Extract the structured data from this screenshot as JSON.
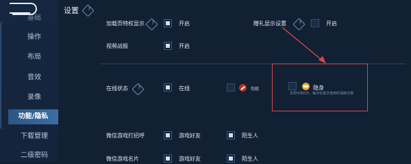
{
  "sidebar": {
    "items": [
      {
        "label": "基础"
      },
      {
        "label": "操作"
      },
      {
        "label": "布局"
      },
      {
        "label": "音效"
      },
      {
        "label": "录像"
      },
      {
        "label": "功能/隐私"
      },
      {
        "label": "下载管理"
      },
      {
        "label": "二级密码"
      }
    ],
    "active_index": 5
  },
  "header": {
    "title": "设置"
  },
  "settings": {
    "load_privilege": {
      "label": "加载页特权显示",
      "option": "开启",
      "checked": true
    },
    "gift_display": {
      "label": "赠礼显示设置",
      "option": "开启",
      "checked": false
    },
    "video_report": {
      "label": "视频战报",
      "option": "开启",
      "checked": true
    },
    "online_status": {
      "label": "在线状态",
      "online": {
        "label": "在线",
        "checked": true
      },
      "dnd": {
        "label": "勿扰",
        "checked": false
      },
      "invisible": {
        "label": "隐身",
        "checked": false
      },
      "invisible_note": "本周可用5次，每日仅首次使用时消耗次数"
    },
    "wechat_invite": {
      "label": "微信游戏打招呼",
      "friends": "游戏好友",
      "strangers": "陌生人"
    },
    "wechat_card": {
      "label": "微信游戏名片",
      "friends": "游戏好友",
      "strangers": "陌生人"
    }
  },
  "colors": {
    "background": "#122034",
    "active_tab": "#3c6ea3",
    "highlight_box": "#d24a4a"
  }
}
